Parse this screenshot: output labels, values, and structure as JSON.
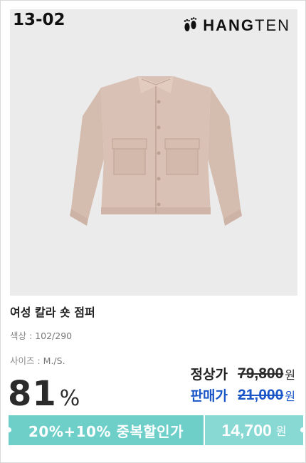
{
  "product_code": "13-02",
  "brand": {
    "name_bold": "HANG",
    "name_thin": "TEN"
  },
  "product": {
    "title": "여성 칼라 숏 점퍼",
    "color_label": "색상 : ",
    "color_value": "102/290",
    "size_label": "사이즈 : ",
    "size_value": "M./S."
  },
  "discount": {
    "rate": "81",
    "unit": "%"
  },
  "pricing": {
    "regular_label": "정상가",
    "regular_price": "79,800",
    "sale_label": "판매가",
    "sale_price": "21,000",
    "currency": "원"
  },
  "promo": {
    "text": "20%+10% 중복할인가",
    "final_price": "14,700",
    "currency": "원"
  },
  "colors": {
    "promo_teal": "#6ecfc9",
    "sale_blue": "#1a56c8",
    "jacket_beige": "#d7bfb2"
  }
}
